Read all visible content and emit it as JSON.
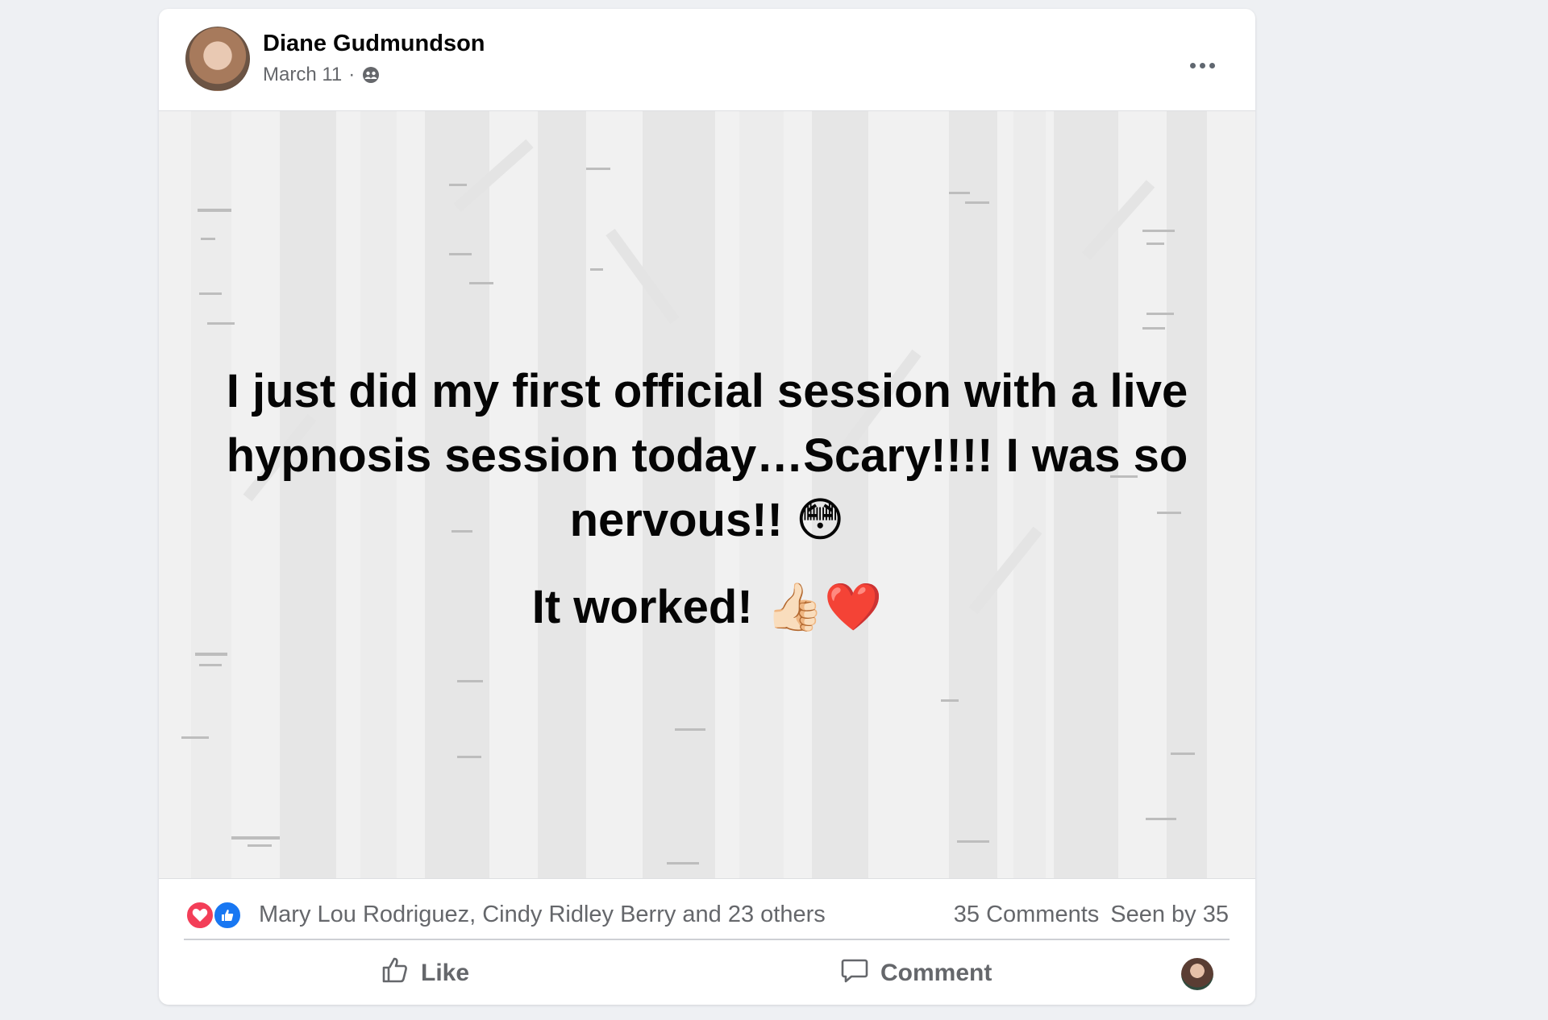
{
  "post": {
    "author": "Diane Gudmundson",
    "date": "March 11",
    "separator": "·",
    "privacy_icon": "friends-icon",
    "text_line1": "I just did my first official session with a live hypnosis session today…Scary!!!! I was so nervous!! 😳",
    "text_line2": "It worked! 👍🏻❤️"
  },
  "reactions": {
    "icons": [
      "heart-reaction-icon",
      "like-reaction-icon"
    ],
    "names": "Mary Lou Rodriguez, Cindy Ridley Berry and 23 others",
    "comments": "35 Comments",
    "seen": "Seen by 35"
  },
  "actions": {
    "like_label": "Like",
    "comment_label": "Comment"
  },
  "colors": {
    "page_bg": "#eef0f3",
    "card_bg": "#ffffff",
    "post_bg": "#f1f1f1",
    "secondary_text": "#65676b",
    "primary_text": "#050505",
    "heart": "#f33e58",
    "like_blue": "#1877f2"
  }
}
